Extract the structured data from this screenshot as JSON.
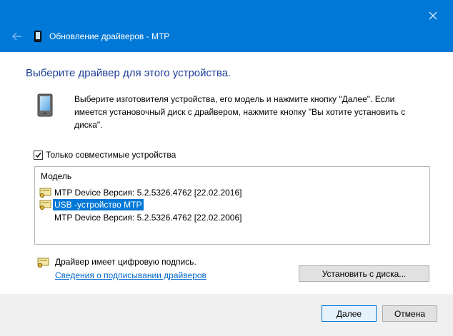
{
  "window": {
    "title": "Обновление драйверов - MTP",
    "titlebar_color": "#0078d7"
  },
  "heading": "Выберите драйвер для этого устройства.",
  "instructions": "Выберите изготовителя устройства, его модель и нажмите кнопку \"Далее\". Если имеется установочный диск с  драйвером, нажмите кнопку \"Вы хотите установить с диска\".",
  "compatible_only": {
    "label": "Только совместимые устройства",
    "checked": true
  },
  "model_list": {
    "header": "Модель",
    "items": [
      {
        "label": "MTP Device Версия: 5.2.5326.4762 [22.02.2016]",
        "icon": "signed-driver-icon",
        "selected": false
      },
      {
        "label": "USB -устройство MTP",
        "icon": "signed-driver-icon",
        "selected": true
      },
      {
        "label": "MTP Device Версия: 5.2.5326.4762 [22.02.2006]",
        "icon": "",
        "selected": false
      }
    ]
  },
  "signature": {
    "text": "Драйвер имеет цифровую подпись.",
    "link": "Сведения о подписывании драйверов"
  },
  "buttons": {
    "have_disk": "Установить с диска...",
    "next": "Далее",
    "cancel": "Отмена"
  },
  "icons": {
    "close": "close-icon",
    "back": "back-arrow-icon",
    "device": "portable-device-icon"
  }
}
